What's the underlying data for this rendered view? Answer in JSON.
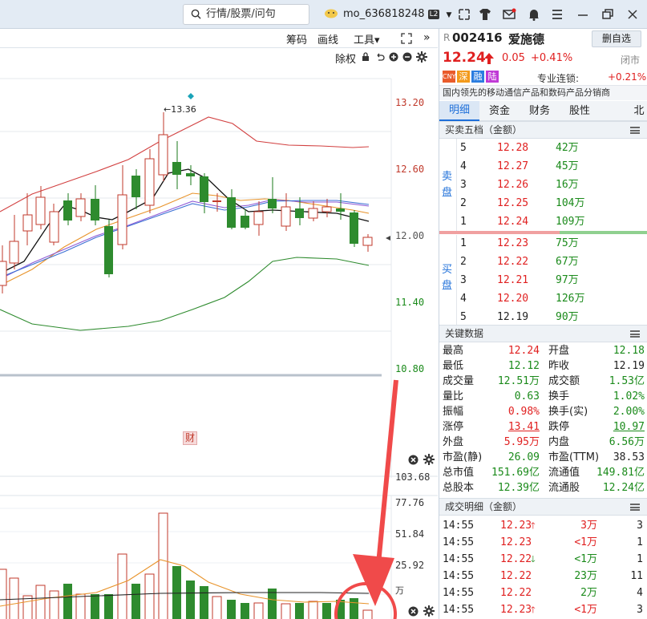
{
  "search": {
    "placeholder": "行情/股票/问句"
  },
  "user": {
    "name": "mo_636818248",
    "badge": "L2"
  },
  "toolbar": {
    "chips": "筹码",
    "draw": "画线",
    "tools": "工具▾",
    "fuquan": "除权"
  },
  "chart": {
    "y_labels": [
      "13.20",
      "12.60",
      "12.00",
      "11.40",
      "10.80"
    ],
    "high_marker": "←13.36",
    "cai_badge": "财",
    "vol_labels": [
      "103.68",
      "77.76",
      "51.84",
      "25.92",
      "万"
    ]
  },
  "stock": {
    "prefix": "R",
    "code": "002416",
    "name": "爱施德",
    "watch_label": "删自选",
    "price": "12.24",
    "change": "0.05",
    "pct": "+0.41%",
    "status": "闭市",
    "tags": [
      "CNY",
      "深",
      "融",
      "陆"
    ],
    "connect": "专业连锁:",
    "connect_pct": "+0.21%",
    "desc": "国内领先的移动通信产品和数码产品分销商"
  },
  "tabs": [
    "明细",
    "资金",
    "财务",
    "股性",
    "北"
  ],
  "orderbook": {
    "title": "买卖五档（金额）",
    "sell_label": "卖盘",
    "buy_label": "买盘",
    "sells": [
      {
        "lvl": "5",
        "price": "12.28",
        "amt": "42万"
      },
      {
        "lvl": "4",
        "price": "12.27",
        "amt": "45万"
      },
      {
        "lvl": "3",
        "price": "12.26",
        "amt": "16万"
      },
      {
        "lvl": "2",
        "price": "12.25",
        "amt": "104万"
      },
      {
        "lvl": "1",
        "price": "12.24",
        "amt": "109万"
      }
    ],
    "buys": [
      {
        "lvl": "1",
        "price": "12.23",
        "amt": "75万"
      },
      {
        "lvl": "2",
        "price": "12.22",
        "amt": "67万"
      },
      {
        "lvl": "3",
        "price": "12.21",
        "amt": "97万"
      },
      {
        "lvl": "4",
        "price": "12.20",
        "amt": "126万"
      },
      {
        "lvl": "5",
        "price": "12.19",
        "amt": "90万"
      }
    ]
  },
  "keydata": {
    "title": "关键数据",
    "rows": [
      {
        "l1": "最高",
        "v1": "12.24",
        "l2": "开盘",
        "v2": "12.18"
      },
      {
        "l1": "最低",
        "v1": "12.12",
        "l2": "昨收",
        "v2": "12.19"
      },
      {
        "l1": "成交量",
        "v1": "12.51万",
        "l2": "成交额",
        "v2": "1.53亿"
      },
      {
        "l1": "量比",
        "v1": "0.63",
        "l2": "换手",
        "v2": "1.02%"
      },
      {
        "l1": "振幅",
        "v1": "0.98%",
        "l2": "换手(实)",
        "v2": "2.00%"
      },
      {
        "l1": "涨停",
        "v1": "13.41",
        "l2": "跌停",
        "v2": "10.97"
      },
      {
        "l1": "外盘",
        "v1": "5.95万",
        "l2": "内盘",
        "v2": "6.56万"
      },
      {
        "l1": "市盈(静)",
        "v1": "26.09",
        "l2": "市盈(TTM)",
        "v2": "38.53"
      },
      {
        "l1": "总市值",
        "v1": "151.69亿",
        "l2": "流通值",
        "v2": "149.81亿"
      },
      {
        "l1": "总股本",
        "v1": "12.39亿",
        "l2": "流通股",
        "v2": "12.24亿"
      }
    ]
  },
  "trades": {
    "title": "成交明细（金额）",
    "rows": [
      {
        "t": "14:55",
        "p": "12.23",
        "d": "up",
        "amt": "3万",
        "n": "3"
      },
      {
        "t": "14:55",
        "p": "12.23",
        "d": "",
        "amt": "<1万",
        "n": "1"
      },
      {
        "t": "14:55",
        "p": "12.22",
        "d": "down",
        "amt": "<1万",
        "n": "1"
      },
      {
        "t": "14:55",
        "p": "12.22",
        "d": "",
        "amt": "23万",
        "n": "11"
      },
      {
        "t": "14:55",
        "p": "12.22",
        "d": "",
        "amt": "2万",
        "n": "4"
      },
      {
        "t": "14:55",
        "p": "12.23",
        "d": "up",
        "amt": "<1万",
        "n": "3"
      }
    ]
  },
  "colors": {
    "up": "#e02020",
    "down": "#1a8a1a",
    "accent": "#1e6fd9",
    "bg_top": "#e3ebf4"
  }
}
